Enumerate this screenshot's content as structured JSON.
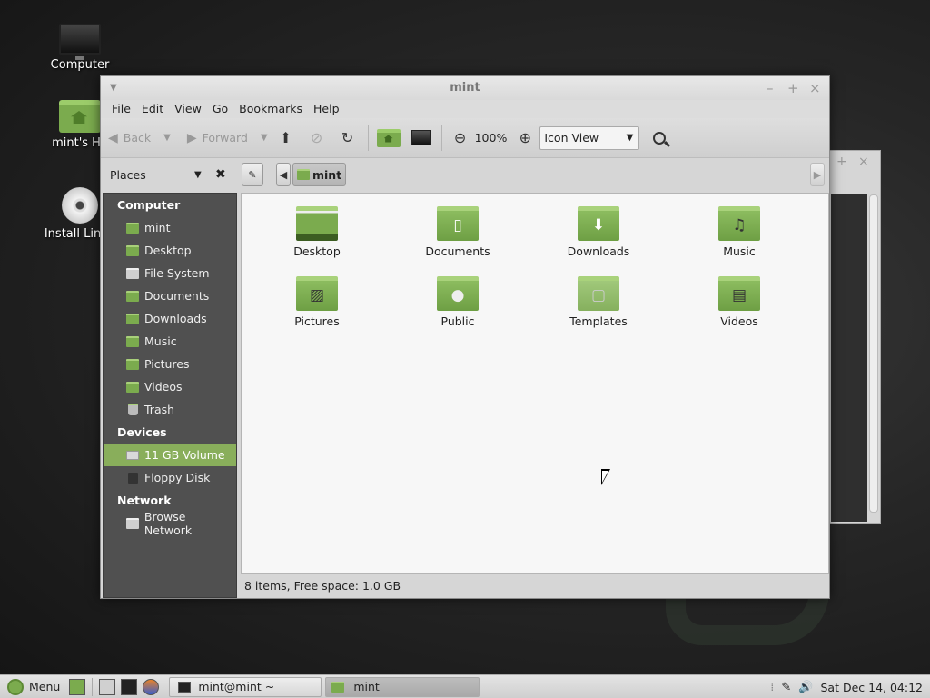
{
  "desktop": {
    "icons": [
      {
        "label": "Computer"
      },
      {
        "label": "mint's Ho"
      },
      {
        "label": "Install Linux"
      }
    ]
  },
  "window": {
    "title": "mint",
    "controls": {
      "minimize": "–",
      "maximize": "+",
      "close": "×"
    },
    "menu": [
      "File",
      "Edit",
      "View",
      "Go",
      "Bookmarks",
      "Help"
    ],
    "toolbar": {
      "back_label": "Back",
      "forward_label": "Forward",
      "zoom_level": "100%",
      "view_mode": "Icon View"
    },
    "sidebar": {
      "header": "Places",
      "sections": [
        {
          "title": "Computer",
          "items": [
            "mint",
            "Desktop",
            "File System",
            "Documents",
            "Downloads",
            "Music",
            "Pictures",
            "Videos",
            "Trash"
          ]
        },
        {
          "title": "Devices",
          "items": [
            "11 GB Volume",
            "Floppy Disk"
          ]
        },
        {
          "title": "Network",
          "items": [
            "Browse Network"
          ]
        }
      ],
      "selected": "11 GB Volume"
    },
    "pathbar": {
      "crumb": "mint"
    },
    "files": [
      {
        "name": "Desktop",
        "icon": "desktop-folder-icon"
      },
      {
        "name": "Documents",
        "icon": "documents-folder-icon"
      },
      {
        "name": "Downloads",
        "icon": "downloads-folder-icon"
      },
      {
        "name": "Music",
        "icon": "music-folder-icon"
      },
      {
        "name": "Pictures",
        "icon": "pictures-folder-icon"
      },
      {
        "name": "Public",
        "icon": "public-folder-icon"
      },
      {
        "name": "Templates",
        "icon": "templates-folder-icon"
      },
      {
        "name": "Videos",
        "icon": "videos-folder-icon"
      }
    ],
    "status": "8 items, Free space: 1.0 GB"
  },
  "panel": {
    "menu_label": "Menu",
    "tasks": [
      {
        "label": "mint@mint ~"
      },
      {
        "label": "mint"
      }
    ],
    "clock": "Sat Dec 14, 04:12"
  },
  "colors": {
    "accent": "#89ae5b",
    "folder": "#7bab4e",
    "sidebar_bg": "#505050"
  }
}
